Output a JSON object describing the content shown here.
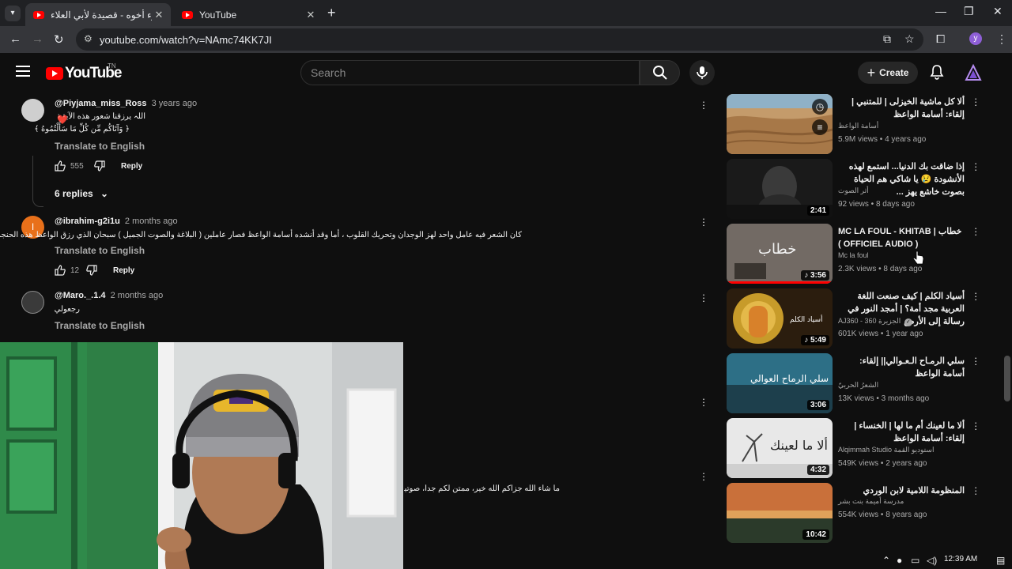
{
  "browser": {
    "tabs": [
      {
        "title": "يسلم المرء أخوه - قصيدة لأبي العلاء",
        "close": "✕"
      },
      {
        "title": "YouTube",
        "close": "✕"
      }
    ],
    "new_tab": "+",
    "url": "youtube.com/watch?v=NAmc74KK7JI",
    "profile_initial": "y",
    "window_controls": {
      "minimize": "—",
      "restore": "❐",
      "close": "✕"
    }
  },
  "header": {
    "logo_text": "YouTube",
    "logo_region": "TN",
    "search_placeholder": "Search",
    "create_label": "Create"
  },
  "comments": [
    {
      "author": "@Piyjama_miss_Ross",
      "time": "3 years ago",
      "lines": [
        "اللہ یرزقنا شعور هذه الآية :",
        "﴿ وَآتَاكُم مِّن كُلِّ مَا سَأَلْتُمُوهُ ﴾"
      ],
      "heart": "❤️",
      "translate": "Translate to English",
      "likes": "555",
      "reply": "Reply",
      "replies_label": "6 replies",
      "avatar_color": "#cfcfcf"
    },
    {
      "author": "@ibrahim-g2i1u",
      "time": "2 months ago",
      "lines": [
        "كان الشعر فيه عامل واحد لهز الوجدان وتحريك القلوب ، أما وقد أنشده أسامة الواعظ فصار عاملين ( البلاغة والصوت الجميل ) سبحان الذي رزق الواعظ هذه الحنجرة !."
      ],
      "translate": "Translate to English",
      "likes": "12",
      "reply": "Reply",
      "avatar_letter": "I",
      "avatar_color": "#e8701a"
    },
    {
      "author": "@Maro._.1.4",
      "time": "2 months ago",
      "lines": [
        "رجعولي"
      ],
      "translate": "Translate to English",
      "avatar_color": "#3a3a3a"
    },
    {
      "lines": [
        "ما شاء الله جزاكم الله خير، ممتن لكم جداً، صوتيات أسامة الواعظ"
      ]
    }
  ],
  "recommendations": [
    {
      "title": "ألا كل ماشية الخيزلى | للمتنبي | إلقاء: أسامة الواعظ",
      "channel": "أسامة الواعظ",
      "meta": "5.9M views • 4 years ago",
      "duration": "",
      "thumb_style": "desert"
    },
    {
      "title": "إذا ضاقت بك الدنيا... استمع لهذه الأنشودة 😢 يا شاكي هم الحياة بصوت خاشع يهز ...",
      "channel": "أثر الصوت",
      "meta": "92 views • 8 days ago",
      "duration": "2:41",
      "thumb_style": "dark"
    },
    {
      "title": "MC LA FOUL - KHITAB | خطاب ( OFFICIEL AUDIO )",
      "channel": "Mc la foul",
      "meta": "2.3K views • 8 days ago",
      "duration": "♪ 3:56",
      "thumb_style": "khitab",
      "progress": 1.0
    },
    {
      "title": "أسياد الكلم | كيف صنعت اللغة العربية مجد أمة؟ | أمجد النور في رسالة إلى الأرض",
      "channel": "AJ360 - 360 الجزيرة",
      "verified": "✓",
      "meta": "601K views • 1 year ago",
      "duration": "♪ 5:49",
      "thumb_style": "golden"
    },
    {
      "title": "سلي الرمـاح الـعـوالي|| إلقاء: أسامة الواعظ",
      "channel": "الشعرُ الحربيّ",
      "meta": "13K views • 3 months ago",
      "duration": "3:06",
      "thumb_style": "blue"
    },
    {
      "title": "ألا ما لعينك أم ما لها | الخنساء | إلقاء: أسامة الواعظ",
      "channel": "Alqimmah Studio استوديو القمة",
      "meta": "549K views • 2 years ago",
      "duration": "4:32",
      "thumb_style": "white"
    },
    {
      "title": "المنظومة اللامية لابن الوردي",
      "channel": "مدرسة أميمة بنت بشر",
      "meta": "554K views • 8 years ago",
      "duration": "10:42",
      "thumb_style": "sunset"
    }
  ],
  "taskbar": {
    "time": "12:39 AM"
  },
  "colors": {
    "accent": "#ff0000",
    "bg": "#0f0f0f",
    "text_secondary": "#aaaaaa"
  }
}
